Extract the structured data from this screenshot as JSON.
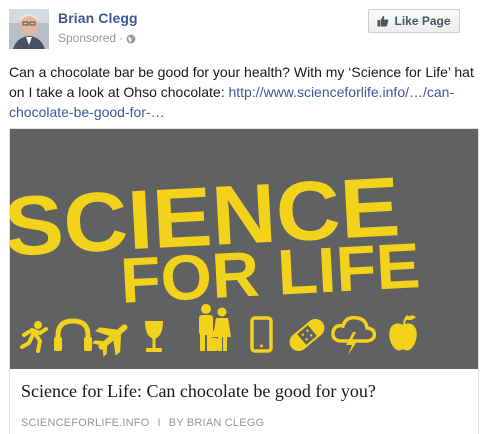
{
  "post": {
    "author": "Brian Clegg",
    "sponsored_label": "Sponsored",
    "dot": "·",
    "like_button_label": "Like Page",
    "text_before_link": "Can a chocolate bar be good for your health? With my ‘Science for Life’ hat on I take a look at Ohso chocolate: ",
    "link_text": "http://www.scienceforlife.info/…/can-chocolate-be-good-for-…"
  },
  "card": {
    "image_line1": "SCIENCE",
    "image_line2": "FOR LIFE",
    "title": "Science for Life: Can chocolate be good for you?",
    "domain": "SCIENCEFORLIFE.INFO",
    "separator": "I",
    "byline": "BY BRIAN CLEGG"
  },
  "colors": {
    "brand_link": "#3b5998",
    "logo_yellow": "#f3d21b",
    "image_background": "#5f6163"
  },
  "icons": [
    "running-person-icon",
    "headphones-icon",
    "airplane-icon",
    "wine-glass-icon",
    "family-icon",
    "smartphone-icon",
    "bandage-icon",
    "storm-cloud-icon",
    "apple-icon"
  ]
}
